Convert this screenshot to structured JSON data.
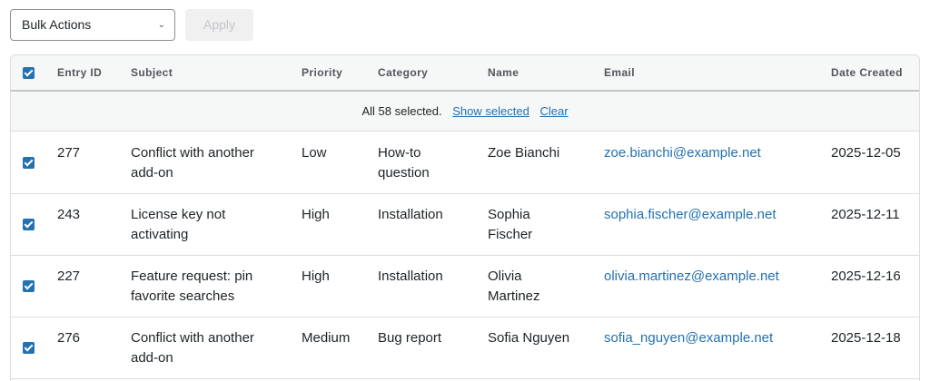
{
  "toolbar": {
    "bulk_actions_label": "Bulk Actions",
    "apply_label": "Apply"
  },
  "table": {
    "headers": {
      "entry_id": "Entry ID",
      "subject": "Subject",
      "priority": "Priority",
      "category": "Category",
      "name": "Name",
      "email": "Email",
      "date_created": "Date Created"
    },
    "selection_banner": {
      "text": "All 58 selected.",
      "show_selected": "Show selected",
      "clear": "Clear"
    },
    "rows": [
      {
        "id": "277",
        "subject": "Conflict with another add-on",
        "priority": "Low",
        "category": "How-to question",
        "name": "Zoe Bianchi",
        "email": "zoe.bianchi@example.net",
        "date": "2025-12-05"
      },
      {
        "id": "243",
        "subject": "License key not activating",
        "priority": "High",
        "category": "Installation",
        "name": "Sophia Fischer",
        "email": "sophia.fischer@example.net",
        "date": "2025-12-11"
      },
      {
        "id": "227",
        "subject": "Feature request: pin favorite searches",
        "priority": "High",
        "category": "Installation",
        "name": "Olivia Martinez",
        "email": "olivia.martinez@example.net",
        "date": "2025-12-16"
      },
      {
        "id": "276",
        "subject": "Conflict with another add-on",
        "priority": "Medium",
        "category": "Bug report",
        "name": "Sofia Nguyen",
        "email": "sofia_nguyen@example.net",
        "date": "2025-12-18"
      }
    ]
  },
  "colors": {
    "accent": "#2271b1",
    "header_bg": "#f6f7f7",
    "border": "#dcdcde"
  },
  "icons": {
    "select_chevron": "chevron-down-icon",
    "checkbox": "checkbox-checked-icon"
  }
}
